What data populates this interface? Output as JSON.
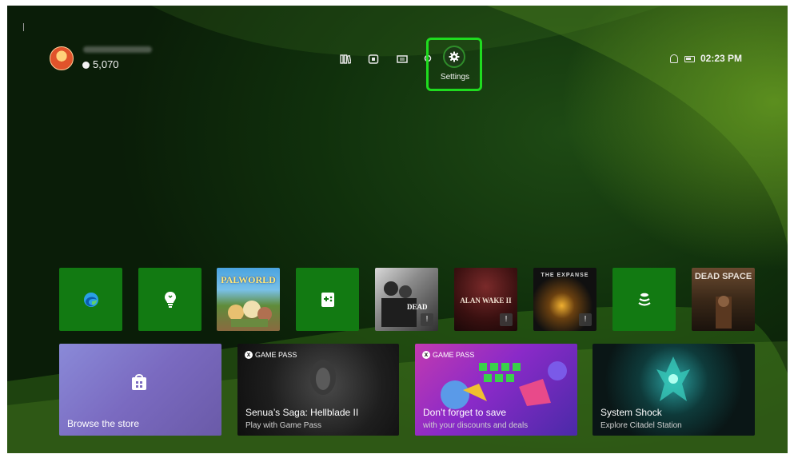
{
  "profile": {
    "points": "5,070"
  },
  "nav": {
    "icons": [
      "library-icon",
      "store-icon",
      "media-icon",
      "search-icon"
    ],
    "settings_label": "Settings"
  },
  "status": {
    "time": "02:23 PM"
  },
  "tiles": [
    {
      "name": "edge-tile",
      "icon": "edge-icon",
      "label": ""
    },
    {
      "name": "tips-tile",
      "icon": "lightbulb-icon",
      "label": ""
    },
    {
      "name": "palworld-tile",
      "label": "PALWORLD"
    },
    {
      "name": "game-pass-app-tile",
      "icon": "controller-icon",
      "label": ""
    },
    {
      "name": "walking-dead-tile",
      "label": "DEAD"
    },
    {
      "name": "alan-wake-tile",
      "label": "ALAN WAKE II"
    },
    {
      "name": "expanse-tile",
      "label": "THE EXPANSE"
    },
    {
      "name": "xbox-app-tile",
      "icon": "stack-icon",
      "label": ""
    },
    {
      "name": "dead-space-tile",
      "label": "DEAD SPACE"
    }
  ],
  "cards": [
    {
      "title": "Browse the store",
      "badge": ""
    },
    {
      "title": "Senua’s Saga: Hellblade II",
      "subtitle": "Play with Game Pass",
      "badge": "GAME PASS"
    },
    {
      "title": "Don’t forget to save",
      "subtitle": "with your discounts and deals",
      "badge": "GAME PASS"
    },
    {
      "title": "System Shock",
      "subtitle": "Explore Citadel Station",
      "badge": ""
    }
  ],
  "colors": {
    "accent": "#1fdc1f",
    "tile_green": "#127a12"
  }
}
